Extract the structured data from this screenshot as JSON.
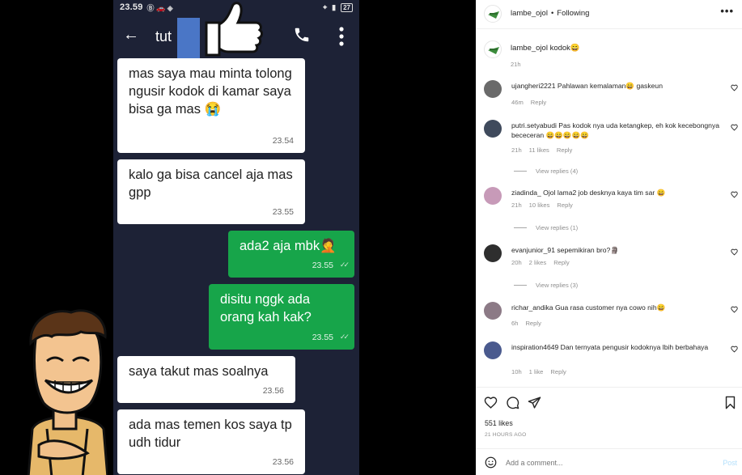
{
  "chat": {
    "status_time": "23.59",
    "status_icons": "Ⓑ 🚗 ◈",
    "battery": "27",
    "contact_name": "tut",
    "messages": [
      {
        "dir": "in",
        "text": "mas saya mau minta tolong ngusir kodok di kamar saya bisa ga mas 😭",
        "time": "23.54"
      },
      {
        "dir": "in",
        "text": "kalo ga bisa cancel aja mas gpp",
        "time": "23.55"
      },
      {
        "dir": "out",
        "text": "ada2 aja mbk🤦",
        "time": "23.55",
        "ticks": "✓✓"
      },
      {
        "dir": "out",
        "text": "disitu nggk ada orang kah kak?",
        "time": "23.55",
        "ticks": "✓✓"
      },
      {
        "dir": "in",
        "text": "saya takut mas soalnya",
        "time": "23.56"
      },
      {
        "dir": "in",
        "text": "ada mas temen kos saya tp udh tidur",
        "time": "23.56"
      }
    ]
  },
  "post": {
    "username": "lambe_ojol",
    "follow_state": "Following",
    "more": "•••",
    "caption": "lambe_ojol kodok😄",
    "caption_time": "21h",
    "likes": "551 likes",
    "posted": "21 HOURS AGO",
    "add_comment_placeholder": "Add a comment...",
    "post_label": "Post",
    "comments": [
      {
        "text": "ujangheri2221 Pahlawan kemalaman😄 gaskeun",
        "time": "46m",
        "likes": "",
        "reply": "Reply",
        "view_replies": "",
        "avatar_color": "#6a6a6a"
      },
      {
        "text": "putri.setyabudi Pas kodok nya uda ketangkep, eh kok kecebongnya bececeran 😄😄😄😄😄",
        "time": "21h",
        "likes": "11 likes",
        "reply": "Reply",
        "view_replies": "View replies (4)",
        "avatar_color": "#3f4a5c"
      },
      {
        "text": "ziadinda_ Ojol lama2 job desknya kaya tim sar 😄",
        "time": "21h",
        "likes": "10 likes",
        "reply": "Reply",
        "view_replies": "View replies (1)",
        "avatar_color": "#c79ab8"
      },
      {
        "text": "evanjunior_91 sepemikiran bro?🗿",
        "time": "20h",
        "likes": "2 likes",
        "reply": "Reply",
        "view_replies": "View replies (3)",
        "avatar_color": "#2e2e2e"
      },
      {
        "text": "richar_andika Gua rasa customer nya cowo nih😄",
        "time": "6h",
        "likes": "",
        "reply": "Reply",
        "view_replies": "",
        "avatar_color": "#8c7a86"
      },
      {
        "text": "inspiration4649 Dan ternyata pengusir kodoknya lbih berbahaya",
        "time": "10h",
        "likes": "1 like",
        "reply": "Reply",
        "view_replies": "",
        "avatar_color": "#4a5a8e"
      }
    ]
  },
  "colors": {
    "chat_bg": "#1d2236",
    "out_bubble": "#17a54a",
    "in_bubble": "#ffffff",
    "post_link": "#b2dffc",
    "muted": "#8e8e8e"
  }
}
